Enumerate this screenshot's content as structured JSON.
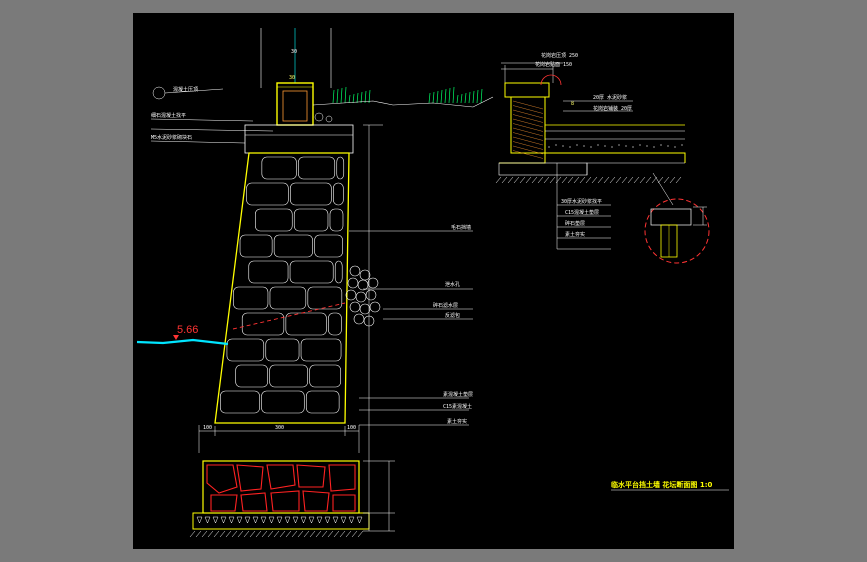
{
  "drawing": {
    "title": "临水平台挡土墙  花坛断面图  1:0",
    "water_level": "5.66",
    "colors": {
      "background": "#000000",
      "frame": "#7a7a7a",
      "outline": "#ffff00",
      "leader": "#ffffff",
      "dimension": "#00ffff",
      "grass": "#00ff66",
      "rubble": "#ff2222",
      "water": "#00e5ff"
    }
  },
  "wall_section": {
    "top_width_label": "30",
    "top_dim_label": "30",
    "left_callouts": [
      "混凝土压顶",
      "细石混凝土找平",
      "M5水泥砂浆砌块石"
    ],
    "right_callouts": [
      "毛石挡墙",
      "泄水孔",
      "碎石滤水层",
      "反滤包"
    ],
    "footing_callouts": [
      "素混凝土垫层",
      "C15素混凝土",
      "素土夯实"
    ],
    "base_dims": [
      "100",
      "300",
      "100"
    ]
  },
  "planter_section": {
    "top_callouts": [
      "花岗岩压顶 250",
      "花岗岩贴面 150"
    ],
    "side_callouts": [
      "20厚 水泥砂浆",
      "花岗岩铺装 20厚"
    ],
    "bottom_callouts": [
      "30厚水泥砂浆找平",
      "C15混凝土垫层",
      "碎石垫层",
      "素土夯实"
    ],
    "dim_label": "8"
  }
}
